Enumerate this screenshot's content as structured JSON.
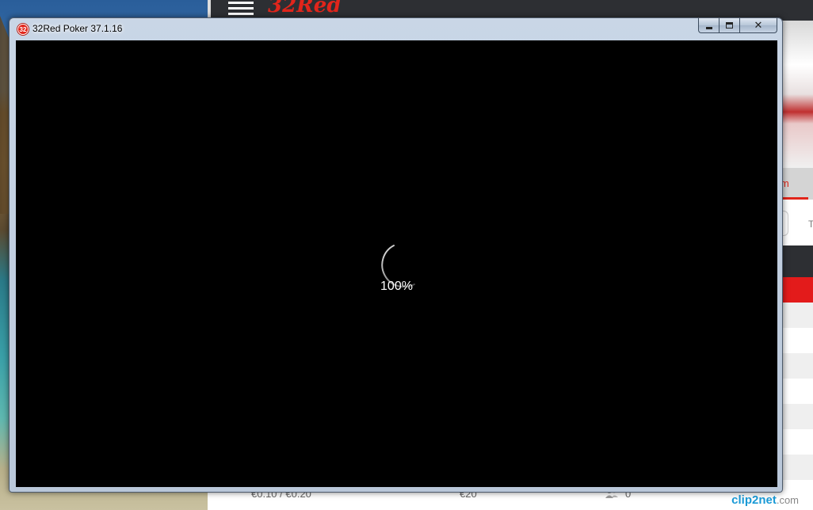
{
  "background_app": {
    "brand": "32Red",
    "tab_label": "m",
    "filter_label": "T",
    "bottom_row": {
      "stakes": "€0.10 / €0.20",
      "buyin": "€20",
      "players": "0"
    },
    "accent_color": "#e1251b"
  },
  "window": {
    "title": "32Red Poker 37.1.16",
    "icon": "32red-logo-icon",
    "controls": {
      "minimize": "minimize-icon",
      "maximize": "maximize-icon",
      "close": "close-icon"
    }
  },
  "loading": {
    "progress_text": "100%",
    "progress_value": 1.0,
    "spinner": "loading-spinner-icon"
  },
  "watermark": {
    "text_main": "clip2net",
    "text_suffix": ".com"
  }
}
